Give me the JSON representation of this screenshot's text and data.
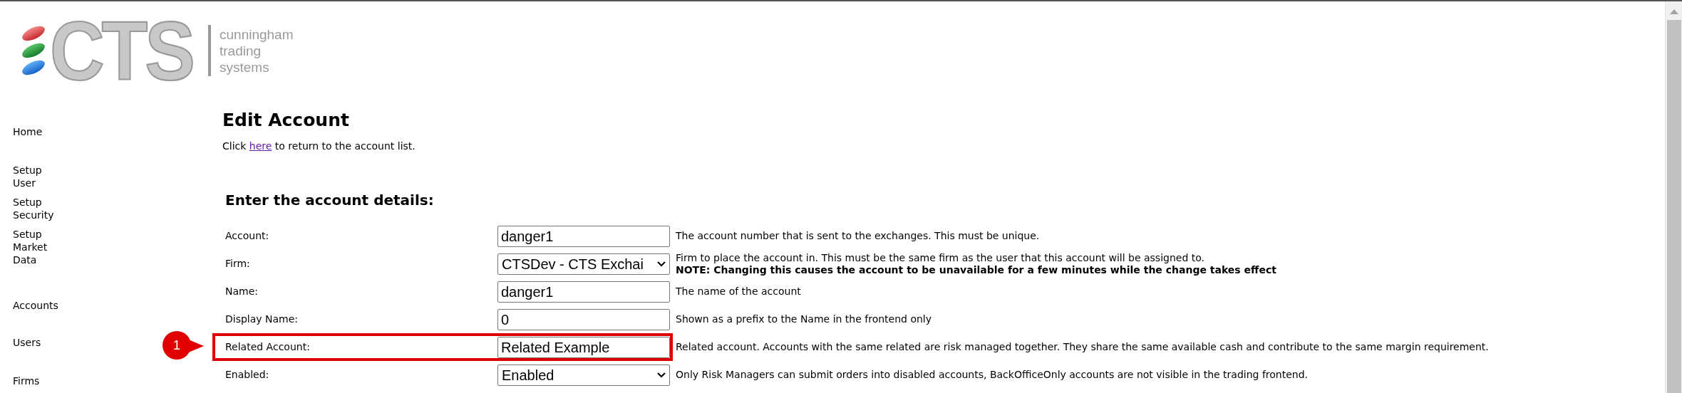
{
  "logo": {
    "letters": "CTS",
    "tagline": [
      "cunningham",
      "trading",
      "systems"
    ]
  },
  "sidebar": {
    "items": [
      {
        "label": "Home"
      },
      {
        "label": "Setup User"
      },
      {
        "label": "Setup Security"
      },
      {
        "label": "Setup Market Data"
      },
      {
        "label": "Accounts"
      },
      {
        "label": "Users"
      },
      {
        "label": "Firms"
      }
    ]
  },
  "page": {
    "title": "Edit Account",
    "intro_before": "Click",
    "intro_link": "here",
    "intro_after": "to return to the account list.",
    "section_title": "Enter the account details:"
  },
  "fields": [
    {
      "label": "Account:",
      "kind": "text",
      "value": "danger1",
      "description": "The account number that is sent to the exchanges. This must be unique.",
      "highlighted": false
    },
    {
      "label": "Firm:",
      "kind": "select",
      "value": "CTSDev - CTS Exchai",
      "description": "Firm to place the account in. This must be the same firm as the user that this account will be assigned to.",
      "note": "NOTE: Changing this causes the account to be unavailable for a few minutes while the change takes effect",
      "highlighted": false
    },
    {
      "label": "Name:",
      "kind": "text",
      "value": "danger1",
      "description": "The name of the account",
      "highlighted": false
    },
    {
      "label": "Display Name:",
      "kind": "text",
      "value": "0",
      "description": "Shown as a prefix to the Name in the frontend only",
      "highlighted": false
    },
    {
      "label": "Related Account:",
      "kind": "text",
      "value": "Related Example",
      "description": "Related account. Accounts with the same related are risk managed together. They share the same available cash and contribute to the same margin requirement.",
      "highlighted": true,
      "callout": "1"
    },
    {
      "label": "Enabled:",
      "kind": "select",
      "value": "Enabled",
      "description": "Only Risk Managers can submit orders into disabled accounts, BackOfficeOnly accounts are not visible in the trading frontend.",
      "highlighted": false
    }
  ]
}
